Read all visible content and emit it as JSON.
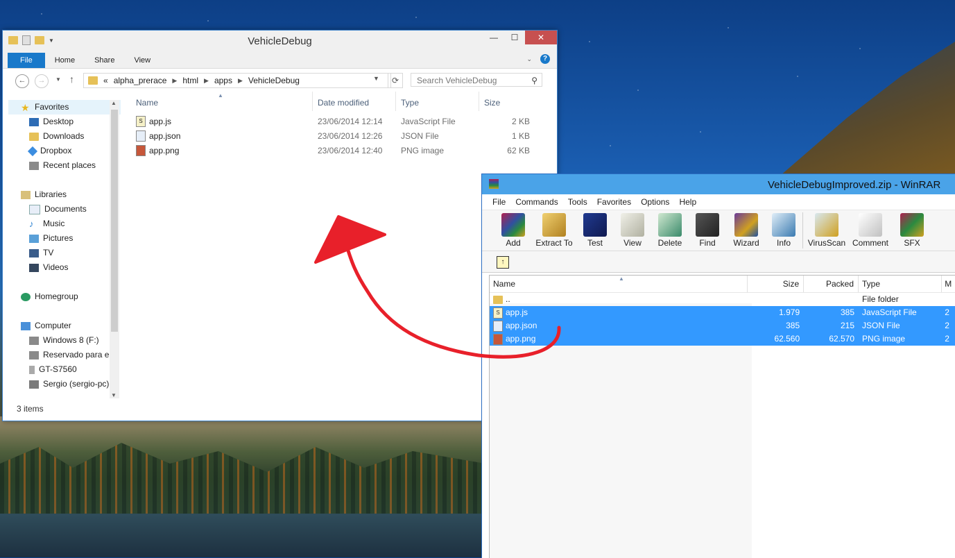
{
  "explorer": {
    "title": "VehicleDebug",
    "ribbon_tabs": [
      "File",
      "Home",
      "Share",
      "View"
    ],
    "address": [
      "«",
      "alpha_prerace",
      "html",
      "apps",
      "VehicleDebug"
    ],
    "search_placeholder": "Search VehicleDebug",
    "nav": {
      "favorites": "Favorites",
      "favorites_items": [
        "Desktop",
        "Downloads",
        "Dropbox",
        "Recent places"
      ],
      "libraries": "Libraries",
      "libraries_items": [
        "Documents",
        "Music",
        "Pictures",
        "TV",
        "Videos"
      ],
      "homegroup": "Homegroup",
      "computer": "Computer",
      "computer_items": [
        "Windows 8 (F:)",
        "Reservado para el",
        "GT-S7560",
        "Sergio (sergio-pc)"
      ]
    },
    "columns": {
      "name": "Name",
      "date": "Date modified",
      "type": "Type",
      "size": "Size"
    },
    "files": [
      {
        "name": "app.js",
        "date": "23/06/2014 12:14",
        "type": "JavaScript File",
        "size": "2 KB"
      },
      {
        "name": "app.json",
        "date": "23/06/2014 12:26",
        "type": "JSON File",
        "size": "1 KB"
      },
      {
        "name": "app.png",
        "date": "23/06/2014 12:40",
        "type": "PNG image",
        "size": "62 KB"
      }
    ],
    "status": "3 items"
  },
  "winrar": {
    "title": "VehicleDebugImproved.zip - WinRAR",
    "menu": [
      "File",
      "Commands",
      "Tools",
      "Favorites",
      "Options",
      "Help"
    ],
    "tools": [
      "Add",
      "Extract To",
      "Test",
      "View",
      "Delete",
      "Find",
      "Wizard",
      "Info",
      "VirusScan",
      "Comment",
      "SFX"
    ],
    "columns": {
      "name": "Name",
      "size": "Size",
      "packed": "Packed",
      "type": "Type",
      "modified": "M"
    },
    "rows": [
      {
        "name": "..",
        "size": "",
        "packed": "",
        "type": "File folder",
        "mod": ""
      },
      {
        "name": "app.js",
        "size": "1.979",
        "packed": "385",
        "type": "JavaScript File",
        "mod": "2"
      },
      {
        "name": "app.json",
        "size": "385",
        "packed": "215",
        "type": "JSON File",
        "mod": "2"
      },
      {
        "name": "app.png",
        "size": "62.560",
        "packed": "62.570",
        "type": "PNG image",
        "mod": "2"
      }
    ]
  },
  "colors": {
    "accent": "#1979ca",
    "selection": "#3399ff",
    "arrow": "#e8202a",
    "winrar_title": "#4aa3e8"
  }
}
